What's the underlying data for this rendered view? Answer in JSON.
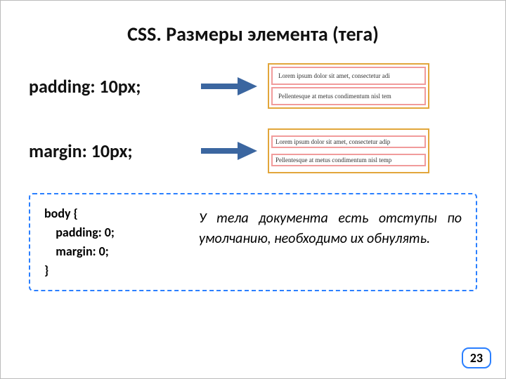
{
  "title": "CSS. Размеры элемента (тега)",
  "rows": {
    "padding": {
      "label": "padding: 10px;",
      "sample1": "Lorem ipsum dolor sit amet, consectetur adi",
      "sample2": "Pellentesque at metus condimentum nisl tem"
    },
    "margin": {
      "label": "margin: 10px;",
      "sample1": "Lorem ipsum dolor sit amet, consectetur adip",
      "sample2": "Pellentesque at metus condimentum nisl temp"
    }
  },
  "callout": {
    "code": "body {\n    padding: 0;\n    margin: 0;\n}",
    "note": "У тела документа есть отступы по умолчанию, необходимо их обнулять."
  },
  "pagenum": "23",
  "colors": {
    "arrow": "#3b66a0",
    "dashed": "#2a7fff",
    "demo_border": "#e2a63b",
    "line_border": "#f19b9b"
  }
}
